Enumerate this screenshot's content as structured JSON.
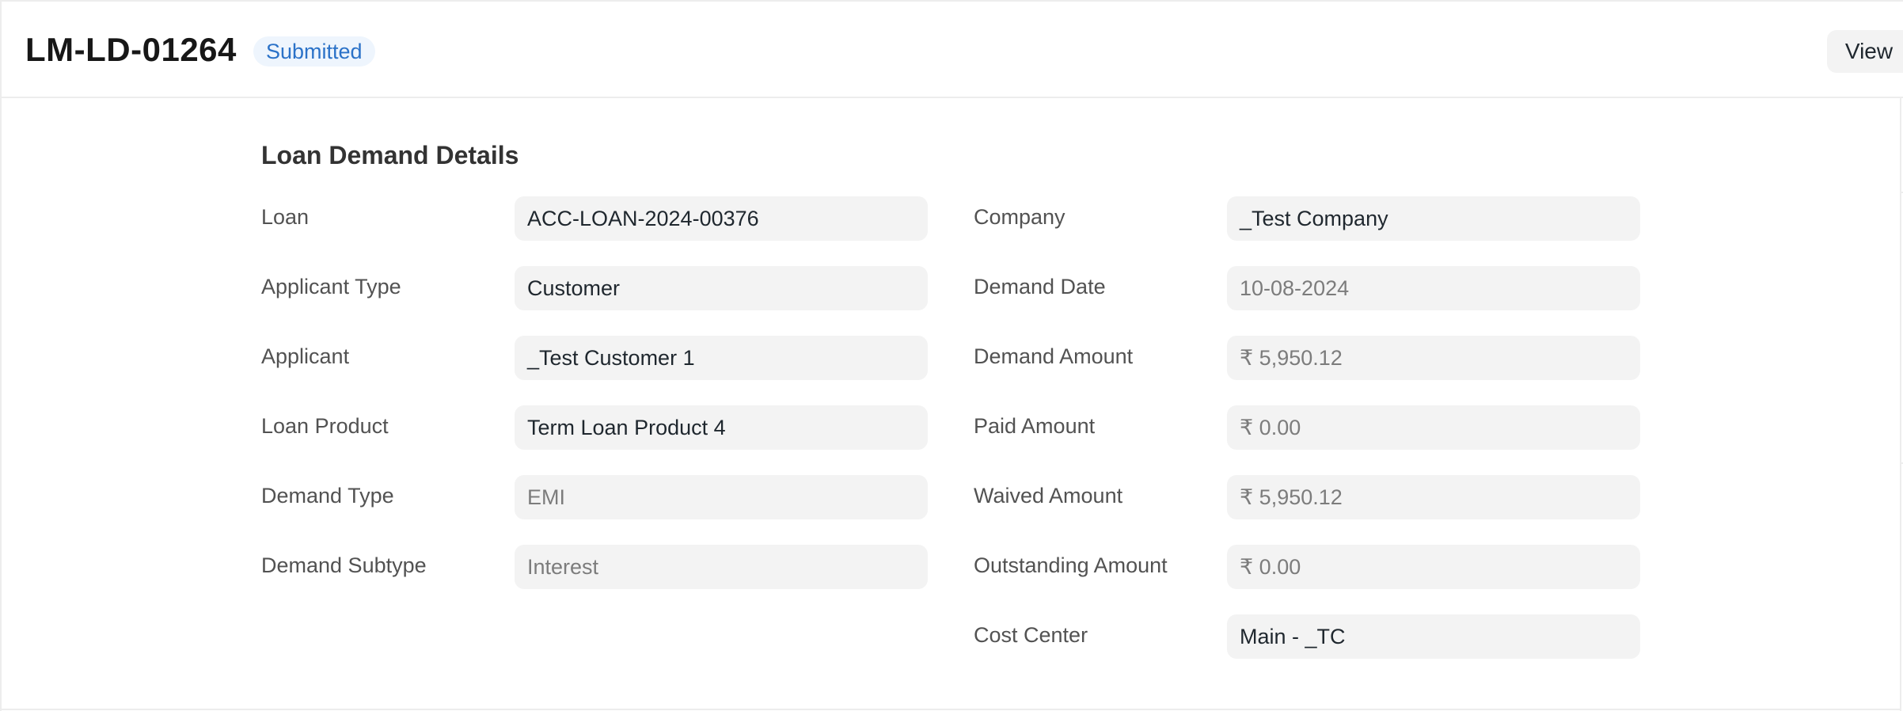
{
  "header": {
    "doc_id": "LM-LD-01264",
    "status": "Submitted",
    "view_label": "View"
  },
  "section": {
    "title": "Loan Demand Details"
  },
  "left_fields": [
    {
      "label": "Loan",
      "value": "ACC-LOAN-2024-00376",
      "readonly": false
    },
    {
      "label": "Applicant Type",
      "value": "Customer",
      "readonly": false
    },
    {
      "label": "Applicant",
      "value": "_Test Customer 1",
      "readonly": false
    },
    {
      "label": "Loan Product",
      "value": "Term Loan Product 4",
      "readonly": false
    },
    {
      "label": "Demand Type",
      "value": "EMI",
      "readonly": true
    },
    {
      "label": "Demand Subtype",
      "value": "Interest",
      "readonly": true
    }
  ],
  "right_fields": [
    {
      "label": "Company",
      "value": "_Test Company",
      "readonly": false
    },
    {
      "label": "Demand Date",
      "value": "10-08-2024",
      "readonly": true
    },
    {
      "label": "Demand Amount",
      "value": "₹ 5,950.12",
      "readonly": true
    },
    {
      "label": "Paid Amount",
      "value": "₹ 0.00",
      "readonly": true
    },
    {
      "label": "Waived Amount",
      "value": "₹ 5,950.12",
      "readonly": true
    },
    {
      "label": "Outstanding Amount",
      "value": "₹ 0.00",
      "readonly": true
    },
    {
      "label": "Cost Center",
      "value": "Main - _TC",
      "readonly": false
    }
  ],
  "colors": {
    "status_badge_bg": "#eef5fd",
    "status_badge_text": "#2b72c8",
    "control_bg": "#f3f3f3",
    "border": "#ededed"
  }
}
